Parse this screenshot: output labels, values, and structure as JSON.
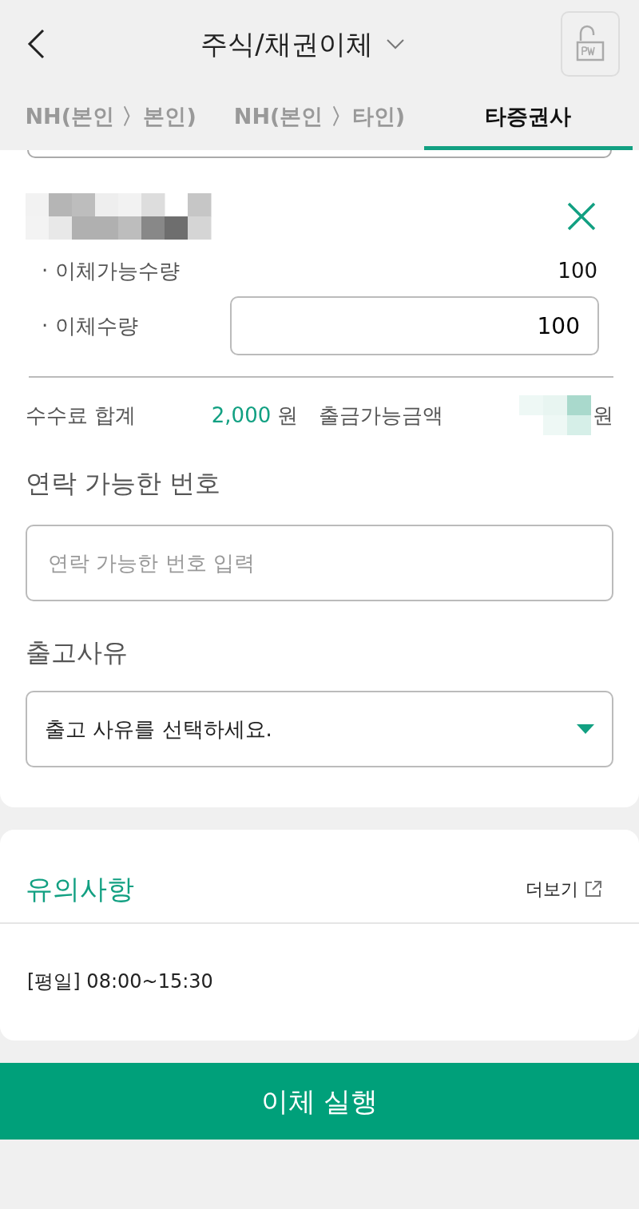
{
  "header": {
    "title": "주식/채권이체"
  },
  "tabs": [
    {
      "label": "NH(본인 〉본인)",
      "selected": false
    },
    {
      "label": "NH(본인 〉타인)",
      "selected": false
    },
    {
      "label": "타증권사",
      "selected": true
    }
  ],
  "stock": {
    "rows": [
      {
        "label": "· 이체가능수량",
        "kind": "text",
        "value": "100"
      },
      {
        "label": "· 이체수량",
        "kind": "input",
        "value": "100"
      }
    ]
  },
  "summary": {
    "fee_label": "수수료 합계",
    "fee": "2,000",
    "fee_unit": "원",
    "available_label": "출금가능금액",
    "available_unit": "원"
  },
  "contact": {
    "label": "연락 가능한 번호",
    "placeholder": "연락 가능한 번호 입력"
  },
  "reason": {
    "label": "출고사유",
    "value": "출고 사유를 선택하세요."
  },
  "notice": {
    "title": "유의사항",
    "more": "더보기",
    "text": "[평일] 08:00~15:30"
  },
  "submit": "이체 실행"
}
